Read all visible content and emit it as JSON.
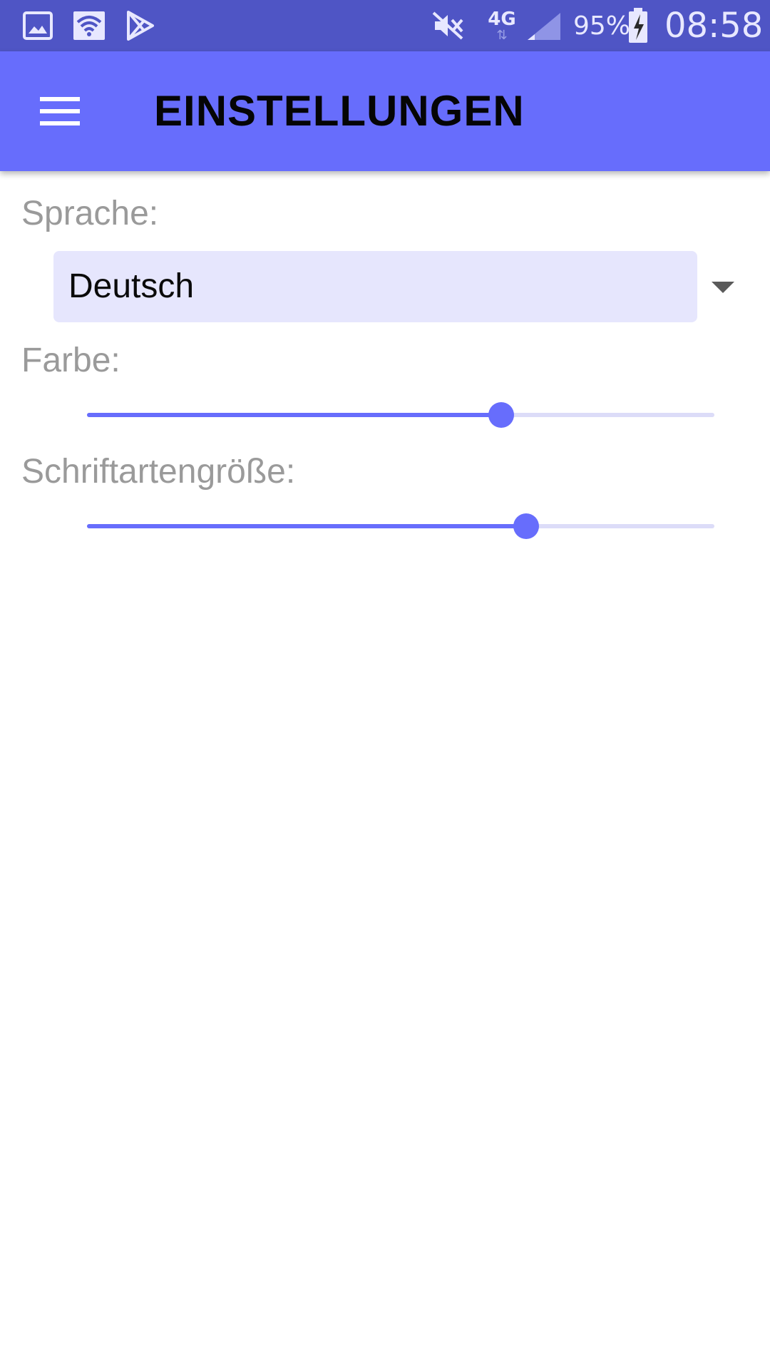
{
  "status_bar": {
    "icons_left": [
      "gallery-icon",
      "wifi-icon",
      "play-store-icon"
    ],
    "icons_right": [
      "mute-icon",
      "network-4g-icon",
      "signal-icon",
      "battery-charging-icon"
    ],
    "network_type": "4G",
    "battery_percent": "95%",
    "time": "08:58"
  },
  "app_bar": {
    "title": "EINSTELLUNGEN",
    "menu_icon": "hamburger-icon",
    "color": "#676dfc"
  },
  "settings": {
    "language": {
      "label": "Sprache:",
      "selected": "Deutsch",
      "icon": "chevron-down-icon"
    },
    "color": {
      "label": "Farbe:",
      "value_fraction": 0.66
    },
    "font_size": {
      "label": "Schriftartengröße:",
      "value_fraction": 0.7
    }
  },
  "colors": {
    "status_bar": "#4f55c5",
    "accent": "#676dfc",
    "spinner_bg": "#e6e6fd",
    "label": "#9a9a9a"
  }
}
